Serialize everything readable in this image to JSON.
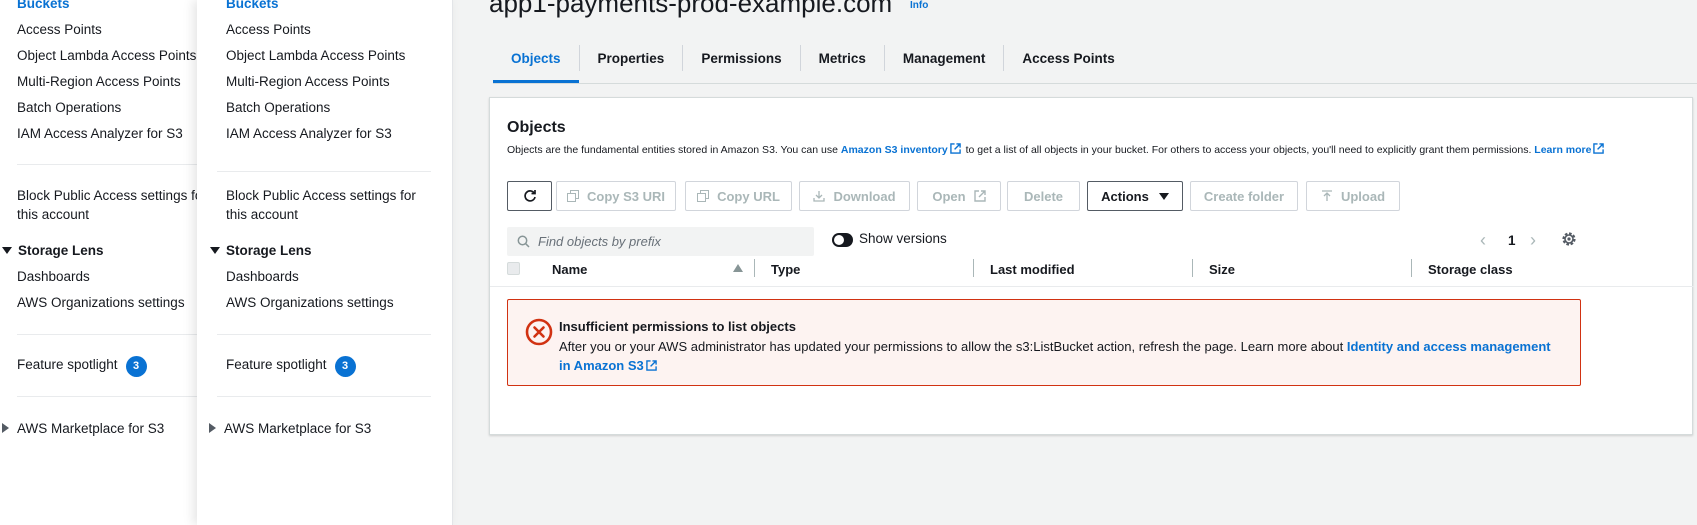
{
  "sidebar": {
    "items": [
      {
        "label": "Buckets"
      },
      {
        "label": "Access Points"
      },
      {
        "label": "Object Lambda Access Points"
      },
      {
        "label": "Multi-Region Access Points"
      },
      {
        "label": "Batch Operations"
      },
      {
        "label": "IAM Access Analyzer for S3"
      }
    ],
    "block_public_access_line1": "Block Public Access settings for",
    "block_public_access_line2": "this account",
    "storage_lens": {
      "title": "Storage Lens",
      "items": [
        {
          "label": "Dashboards"
        },
        {
          "label": "AWS Organizations settings"
        }
      ]
    },
    "feature_spotlight": {
      "label": "Feature spotlight",
      "badge": "3"
    },
    "marketplace": "AWS Marketplace for S3"
  },
  "bucket": {
    "title": "app1-payments-prod-example.com",
    "info": "Info"
  },
  "tabs": [
    {
      "label": "Objects",
      "active": true
    },
    {
      "label": "Properties"
    },
    {
      "label": "Permissions"
    },
    {
      "label": "Metrics"
    },
    {
      "label": "Management"
    },
    {
      "label": "Access Points"
    }
  ],
  "objects": {
    "title": "Objects",
    "description_part1": "Objects are the fundamental entities stored in Amazon S3. You can use ",
    "inventory_link": "Amazon S3 inventory",
    "description_part2": " to get a list of all objects in your bucket. For others to access your objects, you'll need to explicitly grant them permissions. ",
    "learn_more": "Learn more",
    "toolbar": {
      "copy_s3_uri": "Copy S3 URI",
      "copy_url": "Copy URL",
      "download": "Download",
      "open": "Open",
      "delete": "Delete",
      "actions": "Actions",
      "create_folder": "Create folder",
      "upload": "Upload"
    },
    "search_placeholder": "Find objects by prefix",
    "show_versions": "Show versions",
    "page": "1",
    "columns": [
      "Name",
      "Type",
      "Last modified",
      "Size",
      "Storage class"
    ],
    "alert": {
      "title": "Insufficient permissions to list objects",
      "body": "After you or your AWS administrator has updated your permissions to allow the s3:ListBucket action, refresh the page. Learn more about ",
      "link": "Identity and access management in Amazon S3"
    }
  },
  "colors": {
    "accent": "#0972d3",
    "error": "#d13212",
    "error_bg": "#fdf3f1"
  }
}
